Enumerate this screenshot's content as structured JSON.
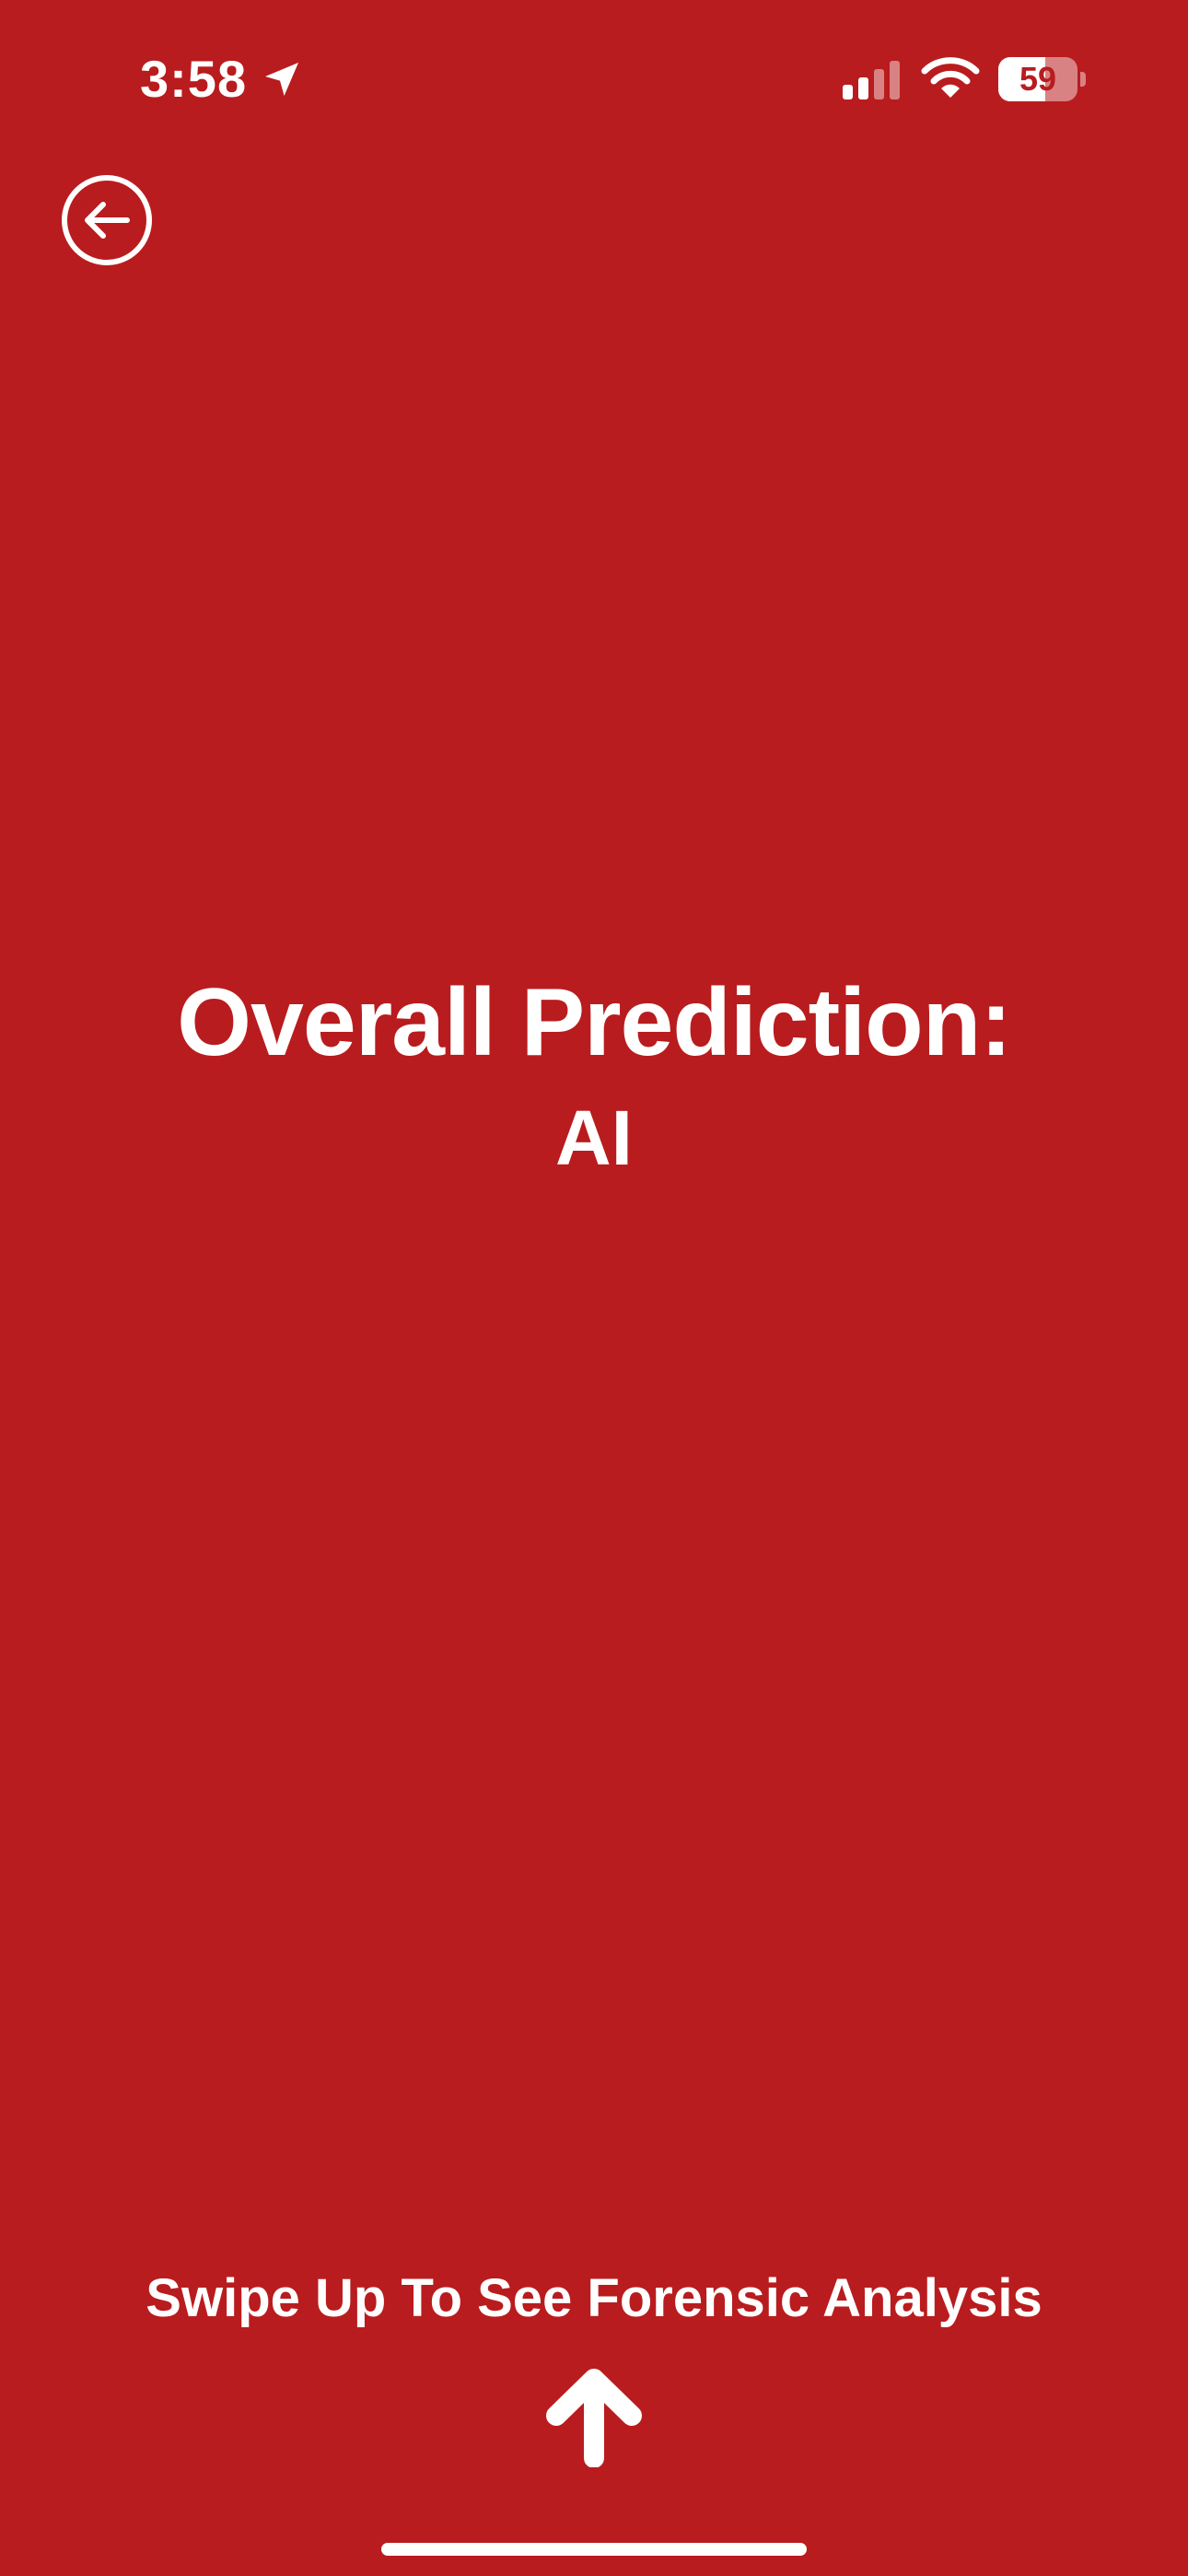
{
  "status_bar": {
    "time": "3:58",
    "battery_level": "59",
    "battery_fraction": 0.59,
    "signal_bars_active": 2,
    "signal_bars_total": 4,
    "icons": [
      "location-arrow-icon",
      "cellular-signal-icon",
      "wifi-icon",
      "battery-icon"
    ]
  },
  "navigation": {
    "back_icon": "arrow-left-circle-icon"
  },
  "prediction": {
    "title": "Overall Prediction:",
    "value": "AI"
  },
  "footer": {
    "swipe_hint": "Swipe Up To See Forensic Analysis",
    "arrow_icon": "arrow-up-icon"
  },
  "colors": {
    "background": "#B91C1E",
    "foreground": "#FFFFFF"
  }
}
